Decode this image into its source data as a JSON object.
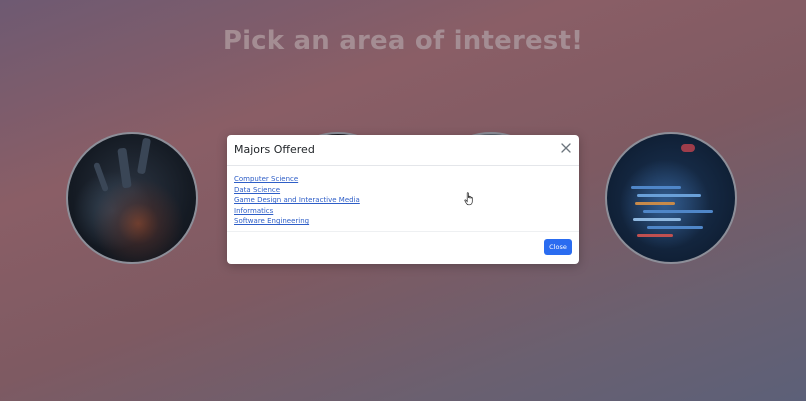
{
  "page": {
    "title": "Pick an area of interest!"
  },
  "modal": {
    "title": "Majors Offered",
    "majors": [
      "Computer Science",
      "Data Science",
      "Game Design and Interactive Media",
      "Informatics",
      "Software Engineering"
    ],
    "close_button_label": "Close",
    "close_icon": "close-icon"
  },
  "colors": {
    "link": "#2e5ec7",
    "primary_button": "#2a6cf0",
    "title_text": "#a48d93"
  }
}
